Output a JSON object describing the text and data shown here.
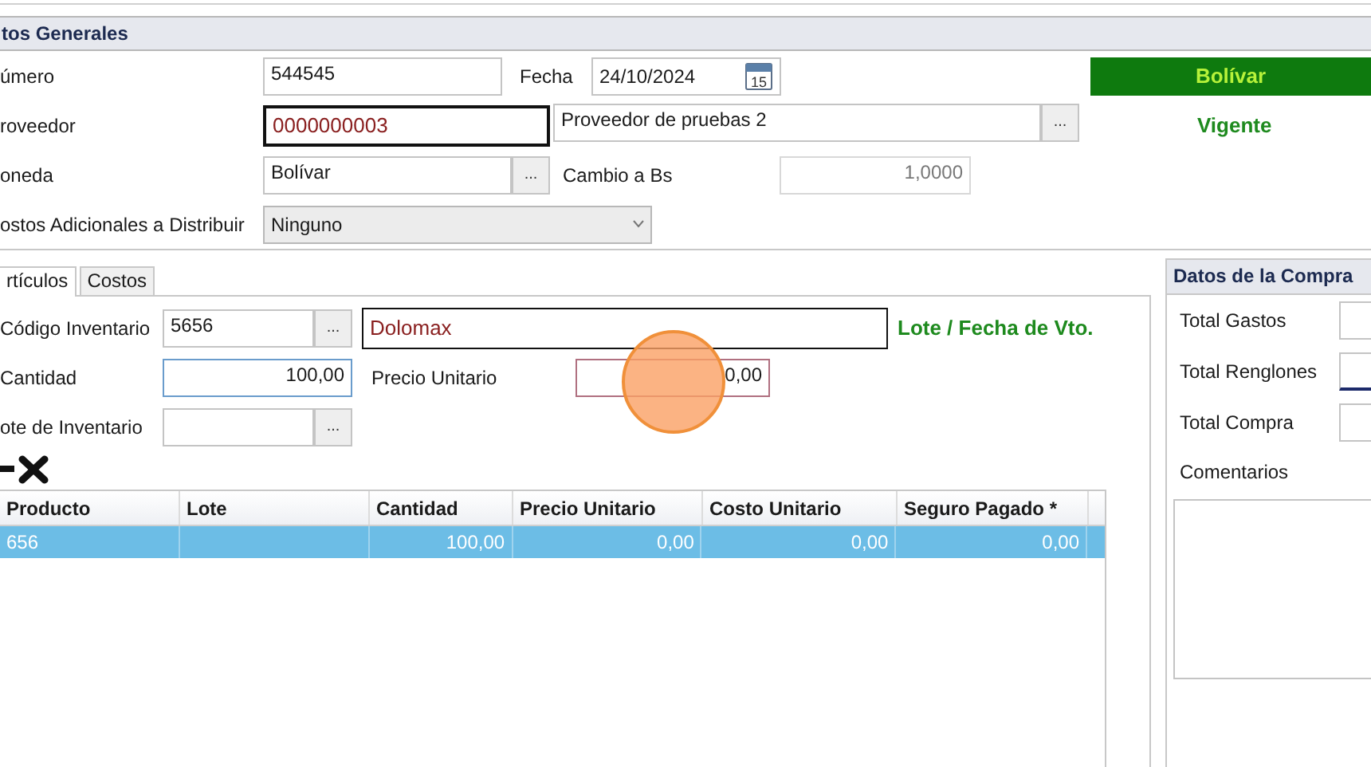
{
  "section_title": "tos Generales",
  "general": {
    "numero": {
      "label": "úmero",
      "value": "544545"
    },
    "fecha": {
      "label": "Fecha",
      "value": "24/10/2024",
      "calendar_day": "15"
    },
    "currency_badge": "Bolívar",
    "proveedor": {
      "label": "roveedor",
      "code": "0000000003",
      "name": "Proveedor de pruebas 2",
      "button": "..."
    },
    "status": "Vigente",
    "moneda": {
      "label": "oneda",
      "value": "Bolívar",
      "button": "..."
    },
    "cambio": {
      "label": "Cambio a Bs",
      "value": "1,0000"
    },
    "costos": {
      "label": "ostos Adicionales a Distribuir",
      "value": "Ninguno"
    }
  },
  "tabs": [
    {
      "label": "rtículos",
      "selected": true
    },
    {
      "label": "Costos",
      "selected": false
    }
  ],
  "articulo": {
    "codigo": {
      "label": "Código Inventario",
      "value": "5656",
      "button": "..."
    },
    "descripcion": "Dolomax",
    "lote_link": "Lote / Fecha de Vto.",
    "cantidad": {
      "label": "Cantidad",
      "value": "100,00"
    },
    "precio": {
      "label": "Precio Unitario",
      "value": "0,00"
    },
    "lote": {
      "label": "ote de Inventario",
      "button": "..."
    }
  },
  "table": {
    "columns": [
      "Producto",
      "Lote",
      "Cantidad",
      "Precio Unitario",
      "Costo Unitario",
      "Seguro Pagado *"
    ],
    "rows": [
      {
        "cells": [
          "656",
          "",
          "100,00",
          "0,00",
          "0,00",
          "0,00"
        ],
        "selected": true
      }
    ]
  },
  "purchase_panel": {
    "title": "Datos de la Compra",
    "fields": [
      {
        "label": "Total Gastos"
      },
      {
        "label": "Total Renglones"
      },
      {
        "label": "Total Compra"
      }
    ],
    "comments_label": "Comentarios"
  }
}
